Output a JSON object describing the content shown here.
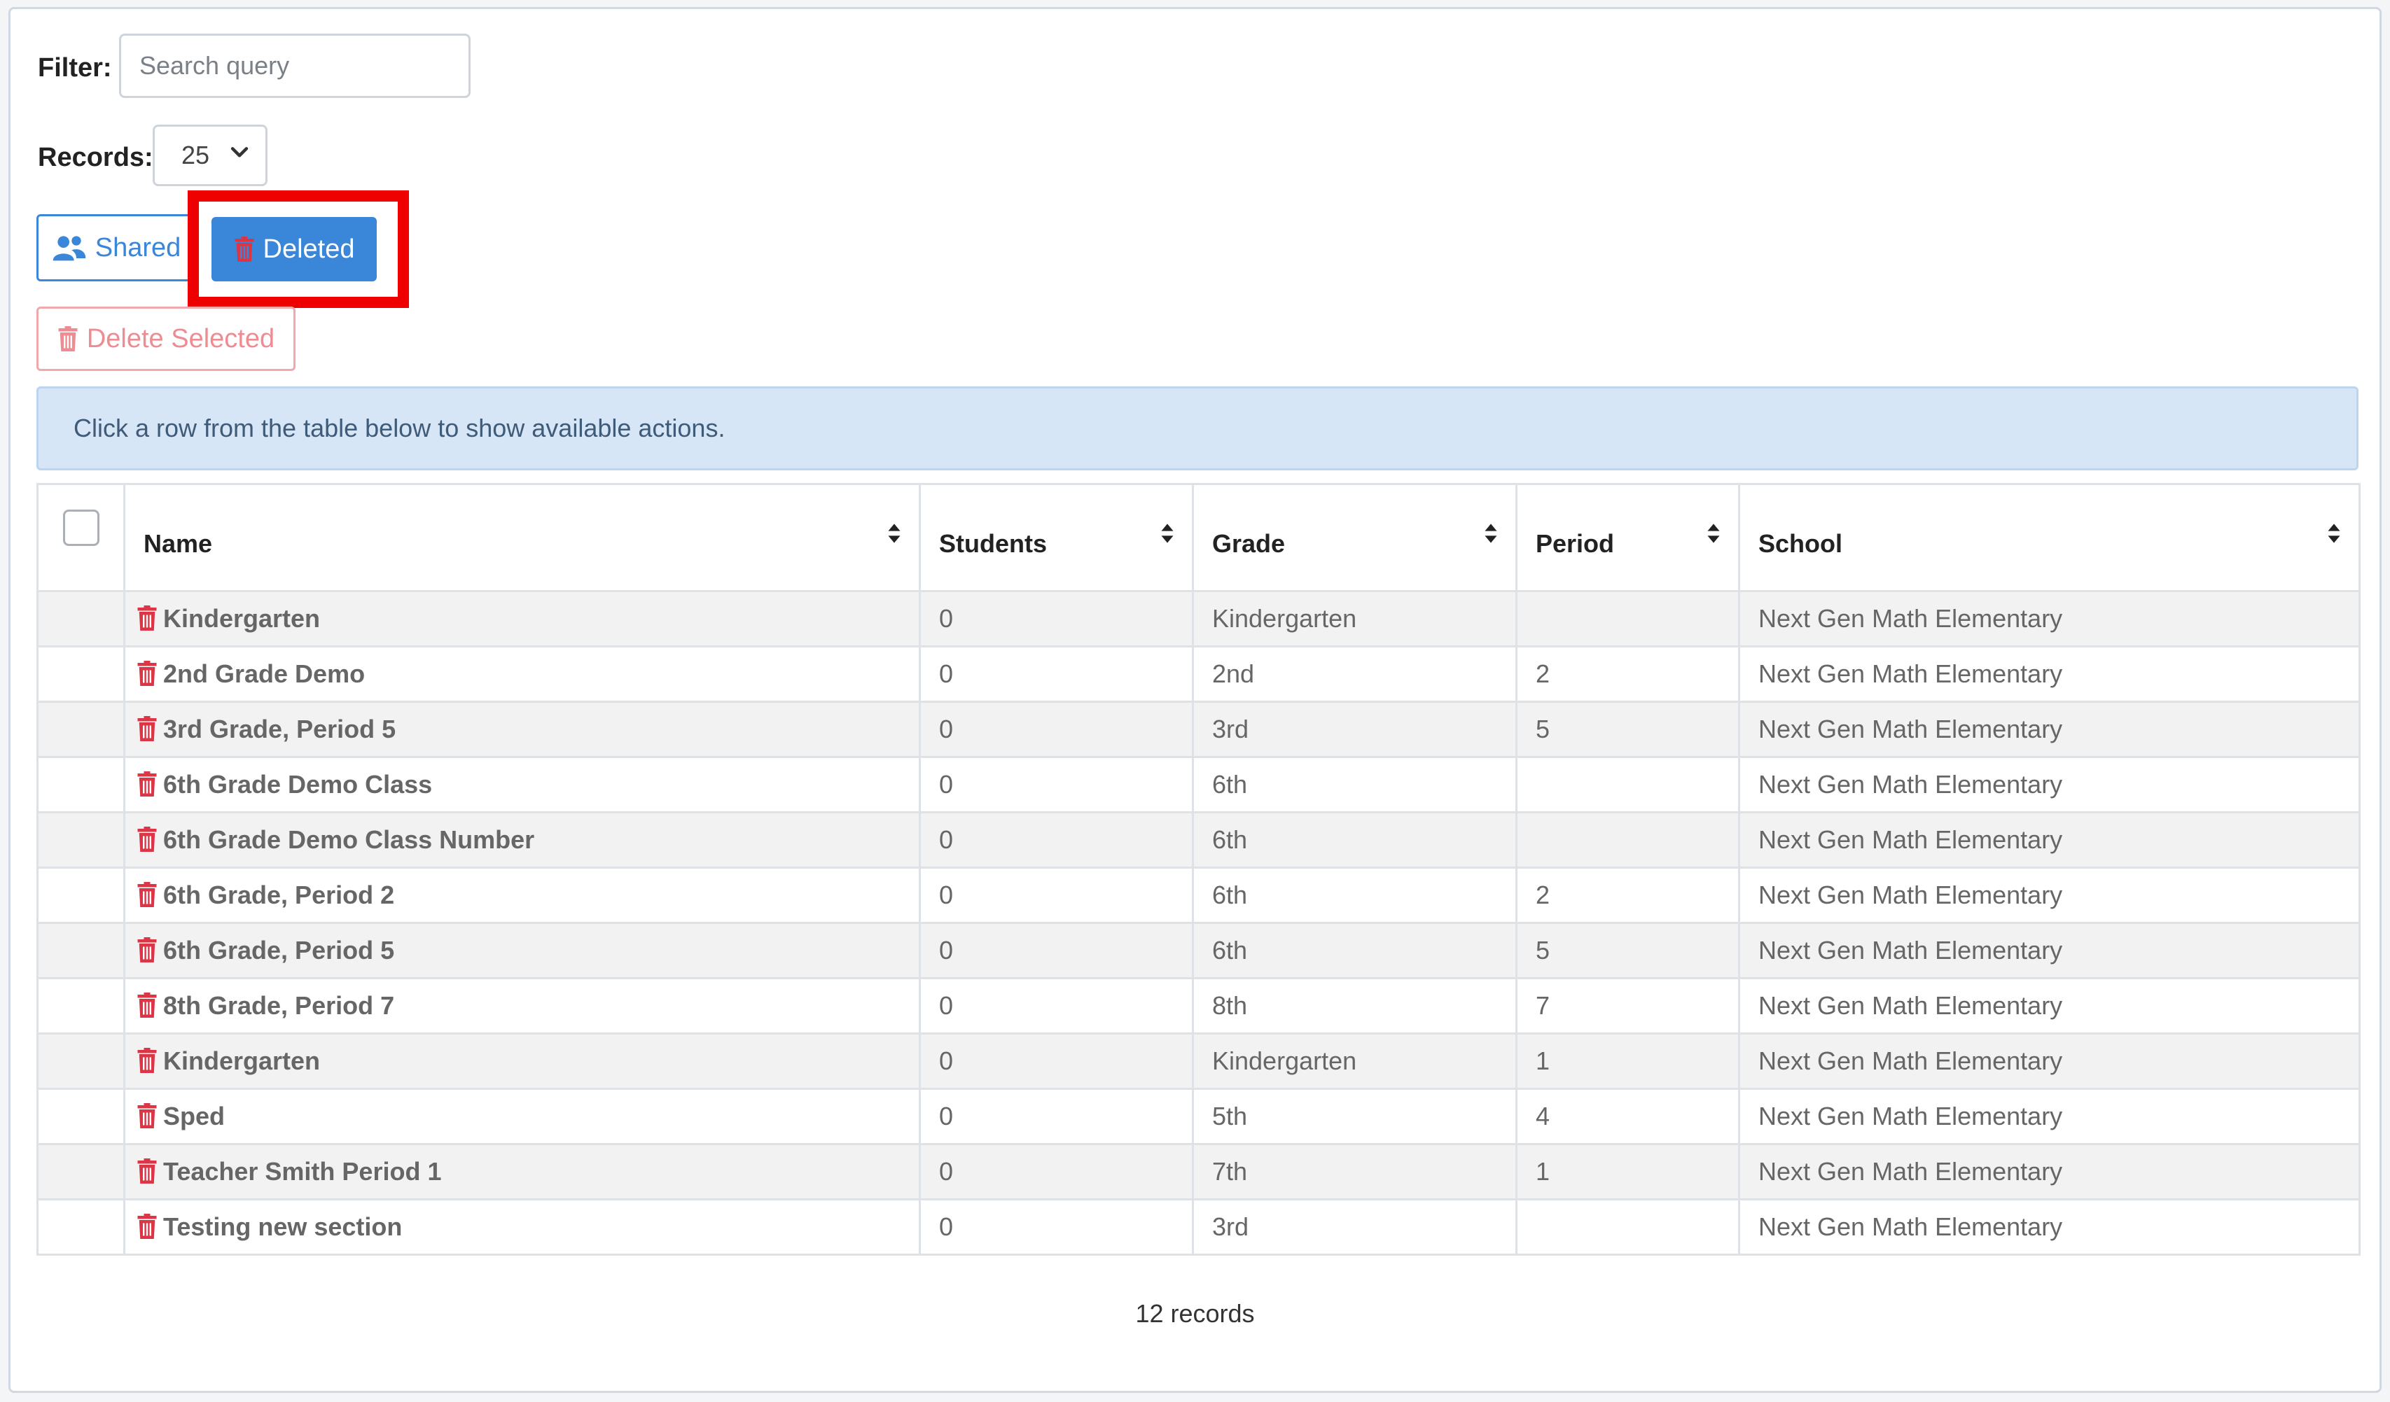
{
  "filter": {
    "label": "Filter:",
    "placeholder": "Search query",
    "value": ""
  },
  "records": {
    "label": "Records:",
    "selected": "25"
  },
  "buttons": {
    "shared": "Shared",
    "deleted": "Deleted",
    "delete_selected": "Delete Selected"
  },
  "alert": "Click a row from the table below to show available actions.",
  "table": {
    "headers": {
      "name": "Name",
      "students": "Students",
      "grade": "Grade",
      "period": "Period",
      "school": "School"
    },
    "rows": [
      {
        "name": "Kindergarten",
        "students": "0",
        "grade": "Kindergarten",
        "period": "",
        "school": "Next Gen Math Elementary"
      },
      {
        "name": "2nd Grade Demo",
        "students": "0",
        "grade": "2nd",
        "period": "2",
        "school": "Next Gen Math Elementary"
      },
      {
        "name": "3rd Grade, Period 5",
        "students": "0",
        "grade": "3rd",
        "period": "5",
        "school": "Next Gen Math Elementary"
      },
      {
        "name": "6th Grade Demo Class",
        "students": "0",
        "grade": "6th",
        "period": "",
        "school": "Next Gen Math Elementary"
      },
      {
        "name": "6th Grade Demo Class Number",
        "students": "0",
        "grade": "6th",
        "period": "",
        "school": "Next Gen Math Elementary"
      },
      {
        "name": "6th Grade, Period 2",
        "students": "0",
        "grade": "6th",
        "period": "2",
        "school": "Next Gen Math Elementary"
      },
      {
        "name": "6th Grade, Period 5",
        "students": "0",
        "grade": "6th",
        "period": "5",
        "school": "Next Gen Math Elementary"
      },
      {
        "name": "8th Grade, Period 7",
        "students": "0",
        "grade": "8th",
        "period": "7",
        "school": "Next Gen Math Elementary"
      },
      {
        "name": "Kindergarten",
        "students": "0",
        "grade": "Kindergarten",
        "period": "1",
        "school": "Next Gen Math Elementary"
      },
      {
        "name": "Sped",
        "students": "0",
        "grade": "5th",
        "period": "4",
        "school": "Next Gen Math Elementary"
      },
      {
        "name": "Teacher Smith Period 1",
        "students": "0",
        "grade": "7th",
        "period": "1",
        "school": "Next Gen Math Elementary"
      },
      {
        "name": "Testing new section",
        "students": "0",
        "grade": "3rd",
        "period": "",
        "school": "Next Gen Math Elementary"
      }
    ]
  },
  "footer": "12 records",
  "icons": {
    "shared": "users-icon",
    "deleted": "trash-icon",
    "row": "trash-icon",
    "sort": "sort-icon",
    "select": "chevron-down-icon"
  },
  "colors": {
    "primary": "#3a86d8",
    "danger": "#dc3545",
    "highlight": "#ee0000",
    "alert_bg": "#d6e6f6"
  }
}
